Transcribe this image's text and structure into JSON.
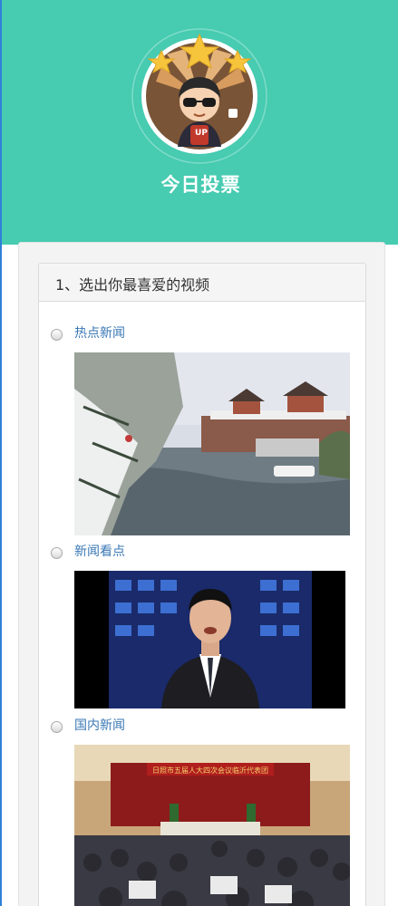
{
  "header": {
    "title": "今日投票",
    "badge_text": "UP"
  },
  "question": {
    "title": "1、选出你最喜爱的视频",
    "options": [
      {
        "label": "热点新闻",
        "image": "snowy canal with traditional pavilions"
      },
      {
        "label": "新闻看点",
        "image": "news anchor in studio"
      },
      {
        "label": "国内新闻",
        "image": "conference hall meeting"
      }
    ],
    "banner_text": "日照市五届人大四次会议临沂代表团"
  },
  "colors": {
    "header_bg": "#47cbb1",
    "link": "#3a78b5"
  }
}
